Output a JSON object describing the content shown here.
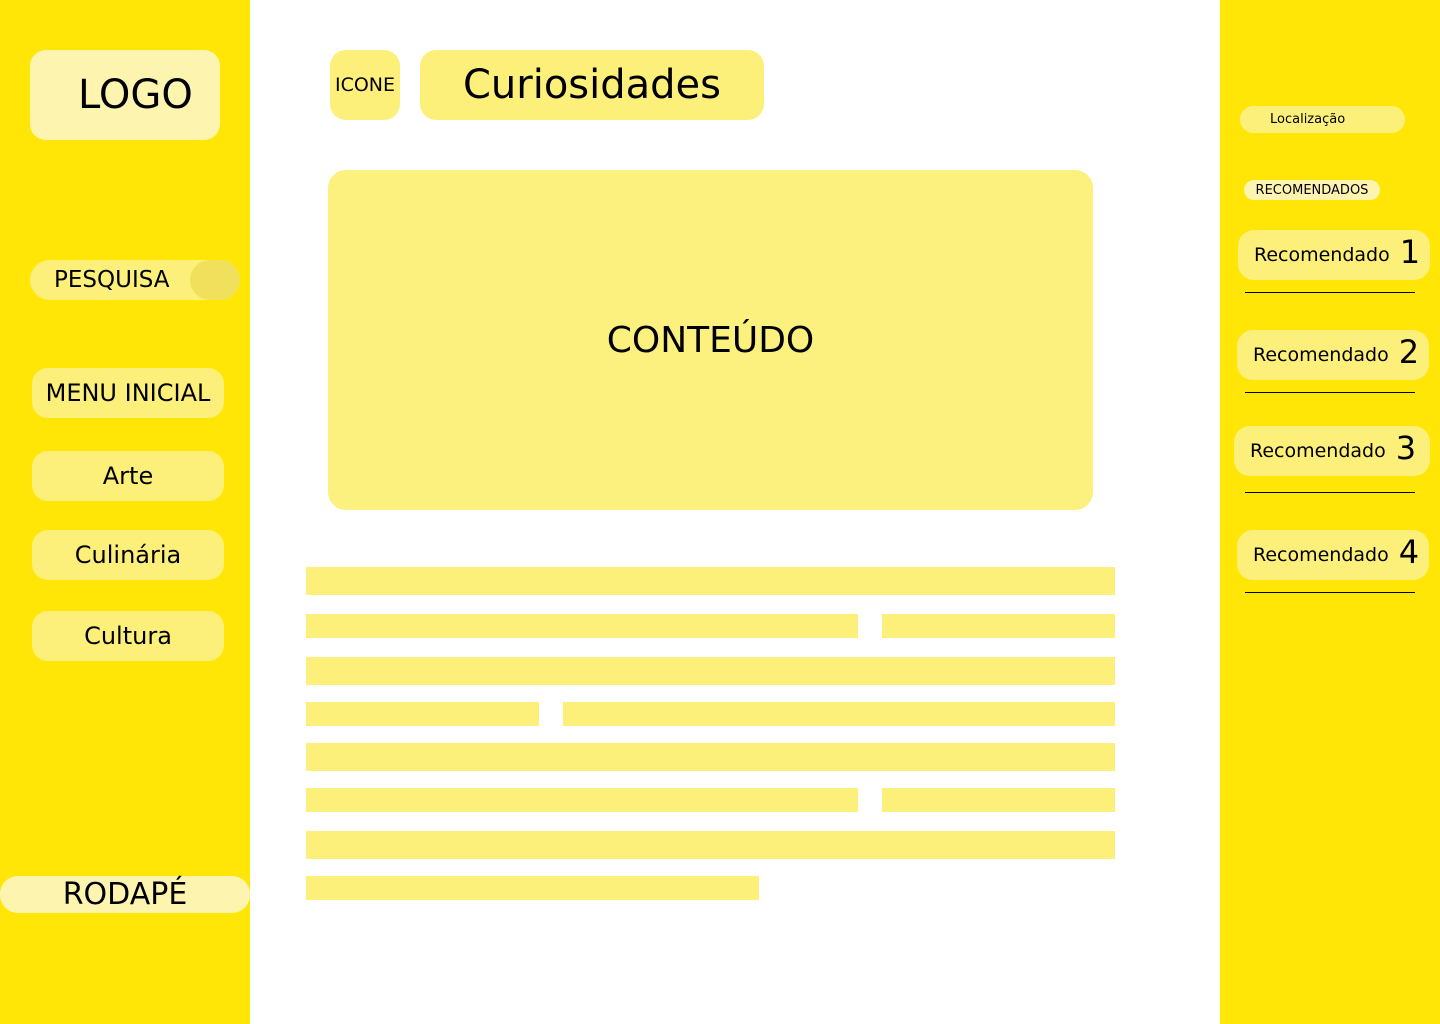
{
  "colors": {
    "sidebar_bg": "#FFE606",
    "pill_bg": "#FDF07A",
    "pale_pill_bg": "#FDF4B0",
    "content_bg": "#FCF07E",
    "main_bg": "#FFFFFF"
  },
  "sidebar": {
    "logo": "LOGO",
    "search_label": "PESQUISA",
    "menu": [
      {
        "label": "MENU INICIAL"
      },
      {
        "label": "Arte"
      },
      {
        "label": "Culinária"
      },
      {
        "label": "Cultura"
      }
    ],
    "footer": "RODAPÉ"
  },
  "header": {
    "icon_label": "ICONE",
    "title": "Curiosidades"
  },
  "main": {
    "content_label": "CONTEÚDO"
  },
  "right_panel": {
    "location": "Localização",
    "recommended_heading": "RECOMENDADOS",
    "recommended": [
      {
        "label": "Recomendado",
        "number": "1"
      },
      {
        "label": "Recomendado",
        "number": "2"
      },
      {
        "label": "Recomendado",
        "number": "3"
      },
      {
        "label": "Recomendado",
        "number": "4"
      }
    ]
  }
}
